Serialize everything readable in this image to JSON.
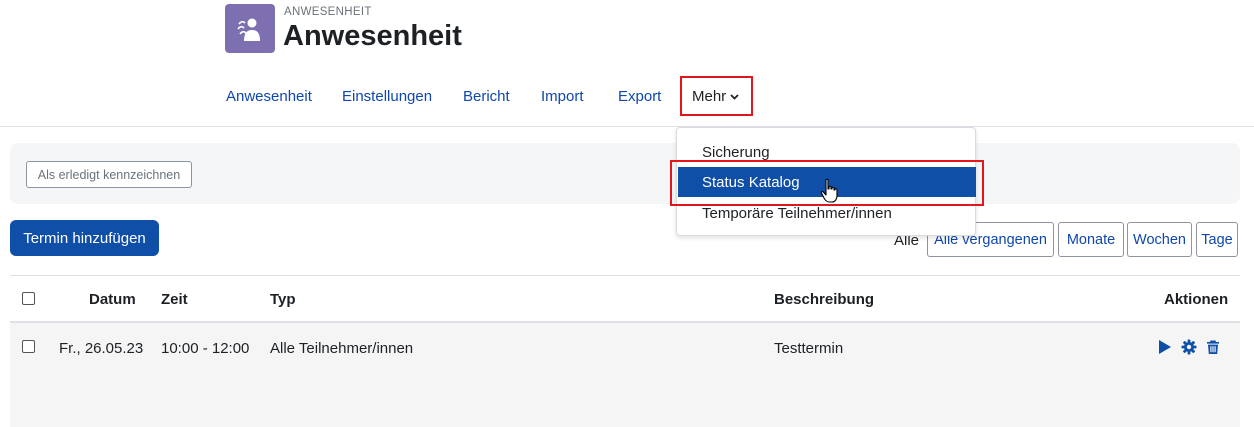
{
  "header": {
    "icon": "attendance-people-icon",
    "pre_title": "ANWESENHEIT",
    "title": "Anwesenheit"
  },
  "nav": {
    "items": [
      {
        "label": "Anwesenheit"
      },
      {
        "label": "Einstellungen"
      },
      {
        "label": "Bericht"
      },
      {
        "label": "Import"
      },
      {
        "label": "Export"
      }
    ],
    "more_label": "Mehr"
  },
  "dropdown": {
    "items": [
      {
        "label": "Sicherung",
        "active": false
      },
      {
        "label": "Status Katalog",
        "active": true
      },
      {
        "label": "Temporäre Teilnehmer/innen",
        "active": false
      }
    ]
  },
  "completion": {
    "mark_done_label": "Als erledigt kennzeichnen"
  },
  "actions": {
    "add_session_label": "Termin hinzufügen"
  },
  "filters": {
    "current_label": "Alle",
    "buttons": [
      {
        "label": "Alle vergangenen"
      },
      {
        "label": "Monate"
      },
      {
        "label": "Wochen"
      },
      {
        "label": "Tage"
      }
    ]
  },
  "table": {
    "headers": {
      "date": "Datum",
      "time": "Zeit",
      "type": "Typ",
      "description": "Beschreibung",
      "actions": "Aktionen"
    },
    "rows": [
      {
        "date": "Fr., 26.05.23",
        "time": "10:00 - 12:00",
        "type": "Alle Teilnehmer/innen",
        "description": "Testtermin"
      }
    ]
  },
  "colors": {
    "primary": "#0f4fa8",
    "link": "#0f47ad",
    "highlight": "#e3161c",
    "module_icon_bg": "#7e6fb0"
  }
}
